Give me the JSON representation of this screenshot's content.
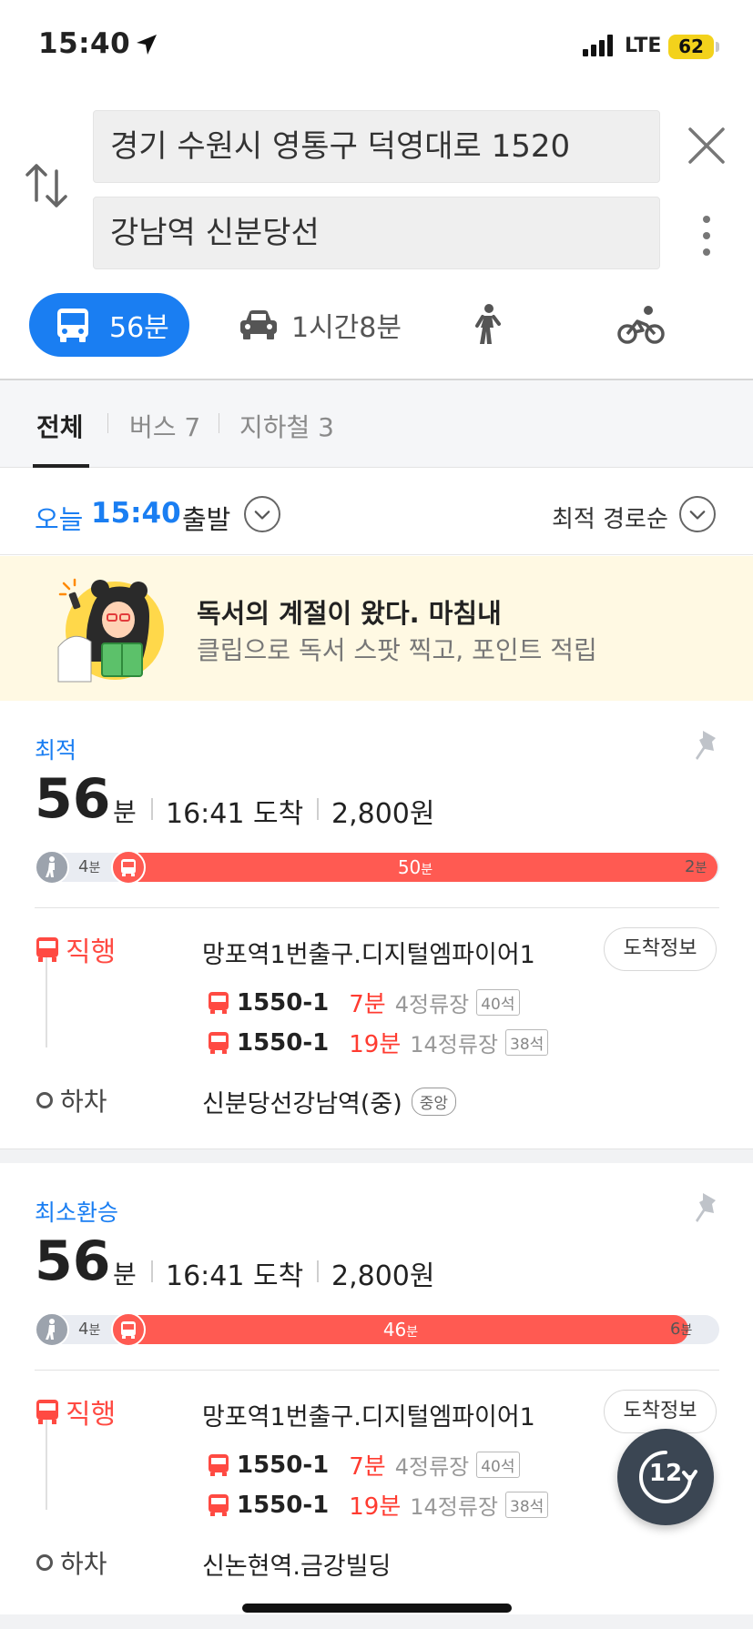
{
  "status_bar": {
    "time": "15:40",
    "network": "LTE",
    "battery": "62"
  },
  "search": {
    "origin": "경기 수원시 영통구 덕영대로 1520",
    "destination": "강남역 신분당선"
  },
  "modes": {
    "transit": "56분",
    "car": "1시간8분"
  },
  "sub_tabs": {
    "all": "전체",
    "bus": "버스 7",
    "subway": "지하철 3"
  },
  "depart": {
    "today": "오늘",
    "time": "15:40",
    "label": "출발",
    "sort": "최적 경로순"
  },
  "banner": {
    "title": "독서의 계절이 왔다. 마침내",
    "subtitle": "클립으로 독서 스팟 찍고, 포인트 적립"
  },
  "routes": [
    {
      "badge": "최적",
      "duration": "56",
      "duration_unit": "분",
      "arrival": "16:41 도착",
      "fare": "2,800원",
      "walk_start": "4",
      "ride": "50",
      "walk_end": "2",
      "unit_min": "분",
      "line_label": "직행",
      "board_stop": "망포역1번출구.디지털엠파이어1",
      "arrival_info": "도착정보",
      "buses": [
        {
          "number": "1550-1",
          "wait": "7분",
          "stops": "4정류장",
          "seats": "40석"
        },
        {
          "number": "1550-1",
          "wait": "19분",
          "stops": "14정류장",
          "seats": "38석"
        }
      ],
      "getoff_label": "하차",
      "getoff_stop": "신분당선강남역(중)",
      "getoff_tag": "중앙"
    },
    {
      "badge": "최소환승",
      "duration": "56",
      "duration_unit": "분",
      "arrival": "16:41 도착",
      "fare": "2,800원",
      "walk_start": "4",
      "ride": "46",
      "walk_end": "6",
      "unit_min": "분",
      "line_label": "직행",
      "board_stop": "망포역1번출구.디지털엠파이어1",
      "arrival_info": "도착정보",
      "buses": [
        {
          "number": "1550-1",
          "wait": "7분",
          "stops": "4정류장",
          "seats": "40석"
        },
        {
          "number": "1550-1",
          "wait": "19분",
          "stops": "14정류장",
          "seats": "38석"
        }
      ],
      "getoff_label": "하차",
      "getoff_stop": "신논현역.금강빌딩"
    }
  ],
  "refresh": {
    "value": "12"
  },
  "colors": {
    "accent": "#1a7ef2",
    "bus_red": "#ff5a52",
    "banner_bg": "#fff9e3"
  },
  "icons": [
    "location-arrow-icon",
    "swap-icon",
    "close-icon",
    "more-icon",
    "bus-icon",
    "car-icon",
    "walk-icon",
    "bike-icon",
    "chevron-down-icon",
    "pin-icon",
    "refresh-icon"
  ]
}
